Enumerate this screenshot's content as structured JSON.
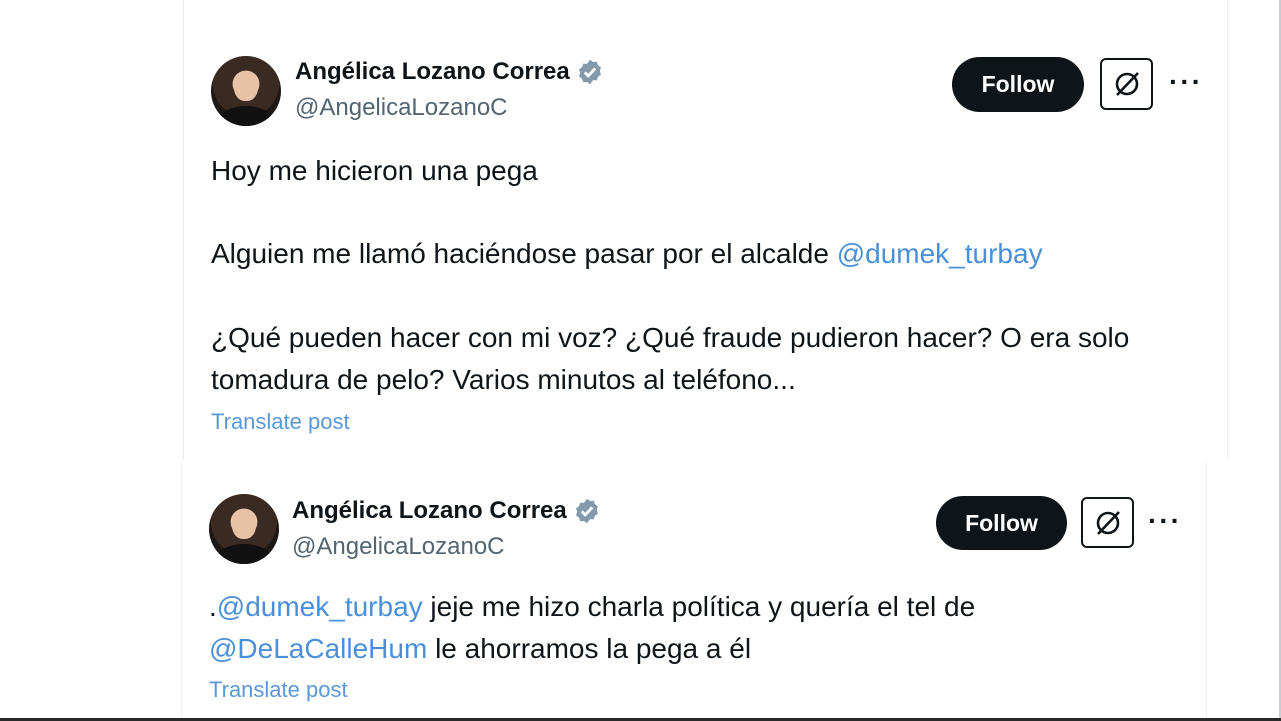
{
  "tweets": [
    {
      "author": "Angélica Lozano Correa",
      "handle": "@AngelicaLozanoC",
      "follow_label": "Follow",
      "more_label": "···",
      "lines": [
        {
          "parts": [
            {
              "text": "Hoy me hicieron una pega"
            }
          ]
        },
        {
          "parts": [
            {
              "text": "Alguien me llamó haciéndose pasar por el alcalde "
            },
            {
              "text": "@dumek_turbay",
              "mention": true
            }
          ]
        },
        {
          "parts": [
            {
              "text": "¿Qué pueden hacer con mi voz? ¿Qué fraude pudieron hacer? O era solo"
            }
          ]
        },
        {
          "parts": [
            {
              "text": "tomadura de pelo? Varios minutos al teléfono..."
            }
          ]
        }
      ],
      "translate_label": "Translate post"
    },
    {
      "author": "Angélica Lozano Correa",
      "handle": "@AngelicaLozanoC",
      "follow_label": "Follow",
      "more_label": "···",
      "lines": [
        {
          "parts": [
            {
              "text": "."
            },
            {
              "text": "@dumek_turbay",
              "mention": true
            },
            {
              "text": " jeje me hizo charla política y quería el tel de"
            }
          ]
        },
        {
          "parts": [
            {
              "text": "@DeLaCalleHum",
              "mention": true
            },
            {
              "text": " le ahorramos la pega a él"
            }
          ]
        }
      ],
      "translate_label": "Translate post"
    }
  ],
  "colors": {
    "mention": "#4a90d9",
    "verified_badge": "#829aab",
    "follow_bg": "#0f1419"
  },
  "icons": {
    "verified": "verified-badge-icon",
    "grok": "grok-icon",
    "more": "more-options-icon"
  }
}
